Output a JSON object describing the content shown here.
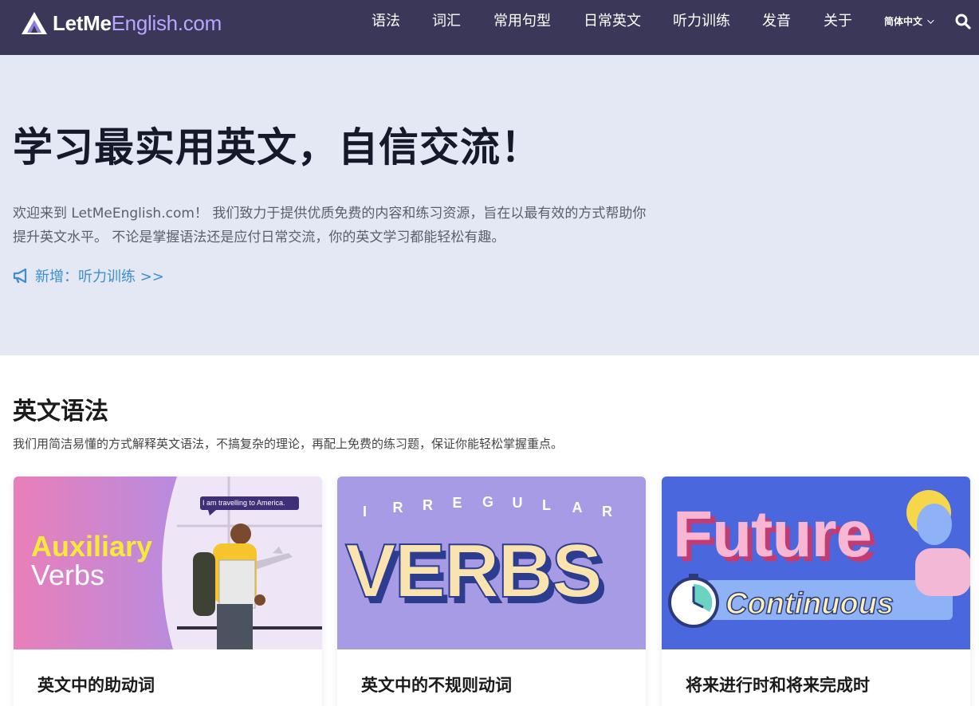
{
  "header": {
    "logo": {
      "brand_bold": "LetMe",
      "brand_light": "English.com"
    },
    "nav": [
      {
        "label": "语法"
      },
      {
        "label": "词汇"
      },
      {
        "label": "常用句型"
      },
      {
        "label": "日常英文"
      },
      {
        "label": "听力训练"
      },
      {
        "label": "发音"
      },
      {
        "label": "关于"
      }
    ],
    "language": "简体中文",
    "search_icon": "search-icon"
  },
  "hero": {
    "title": "学习最实用英文，自信交流！",
    "description": "欢迎来到 LetMeEnglish.com！ 我们致力于提供优质免费的内容和练习资源，旨在以最有效的方式帮助你提升英文水平。 不论是掌握语法还是应付日常交流，你的英文学习都能轻松有趣。",
    "announce_icon": "megaphone-icon",
    "link_label": "新增：听力训练 >>"
  },
  "grammar": {
    "title": "英文语法",
    "description": "我们用简洁易懂的方式解释英文语法，不搞复杂的理论，再配上免费的练习题，保证你能轻松掌握重点。",
    "cards": [
      {
        "title": "英文中的助动词",
        "image": {
          "line1": "Auxiliary",
          "line2": "Verbs",
          "bubble": "I am travelling to America."
        }
      },
      {
        "title": "英文中的不规则动词",
        "image": {
          "top_letters": "IRREGULAR",
          "word": "VERBS"
        }
      },
      {
        "title": "将来进行时和将来完成时",
        "image": {
          "line1": "Future",
          "line2": "Continuous"
        }
      }
    ]
  },
  "colors": {
    "header_bg": "#3a3758",
    "hero_bg": "#e4e7f4",
    "link": "#3d8fd0",
    "logo_accent": "#b9a7ff"
  }
}
